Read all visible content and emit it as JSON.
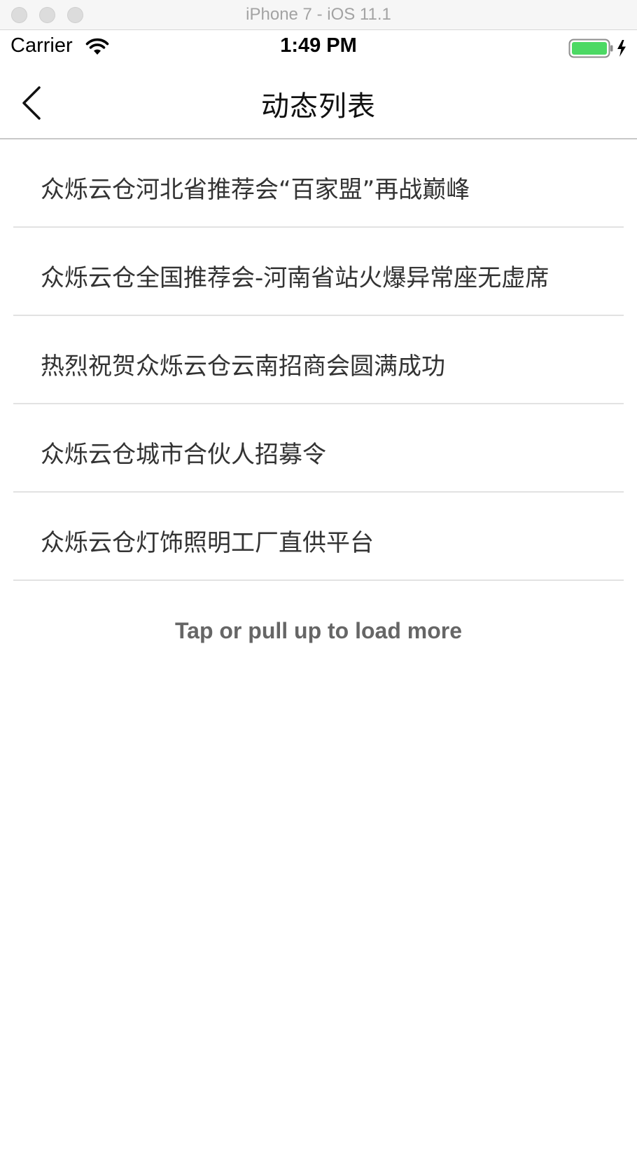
{
  "window": {
    "title": "iPhone 7 - iOS 11.1"
  },
  "status_bar": {
    "carrier": "Carrier",
    "time": "1:49 PM",
    "wifi_icon": "wifi-icon",
    "battery_icon": "battery-charging-icon",
    "battery_level": 1.0,
    "battery_color": "#4cd964"
  },
  "nav": {
    "back_icon": "chevron-left-icon",
    "title": "动态列表"
  },
  "list": {
    "items": [
      {
        "title": "众烁云仓河北省推荐会“百家盟”再战巅峰"
      },
      {
        "title": "众烁云仓全国推荐会-河南省站火爆异常座无虚席"
      },
      {
        "title": "热烈祝贺众烁云仓云南招商会圆满成功"
      },
      {
        "title": "众烁云仓城市合伙人招募令"
      },
      {
        "title": "众烁云仓灯饰照明工厂直供平台"
      }
    ]
  },
  "footer": {
    "load_more": "Tap or pull up to load more"
  }
}
